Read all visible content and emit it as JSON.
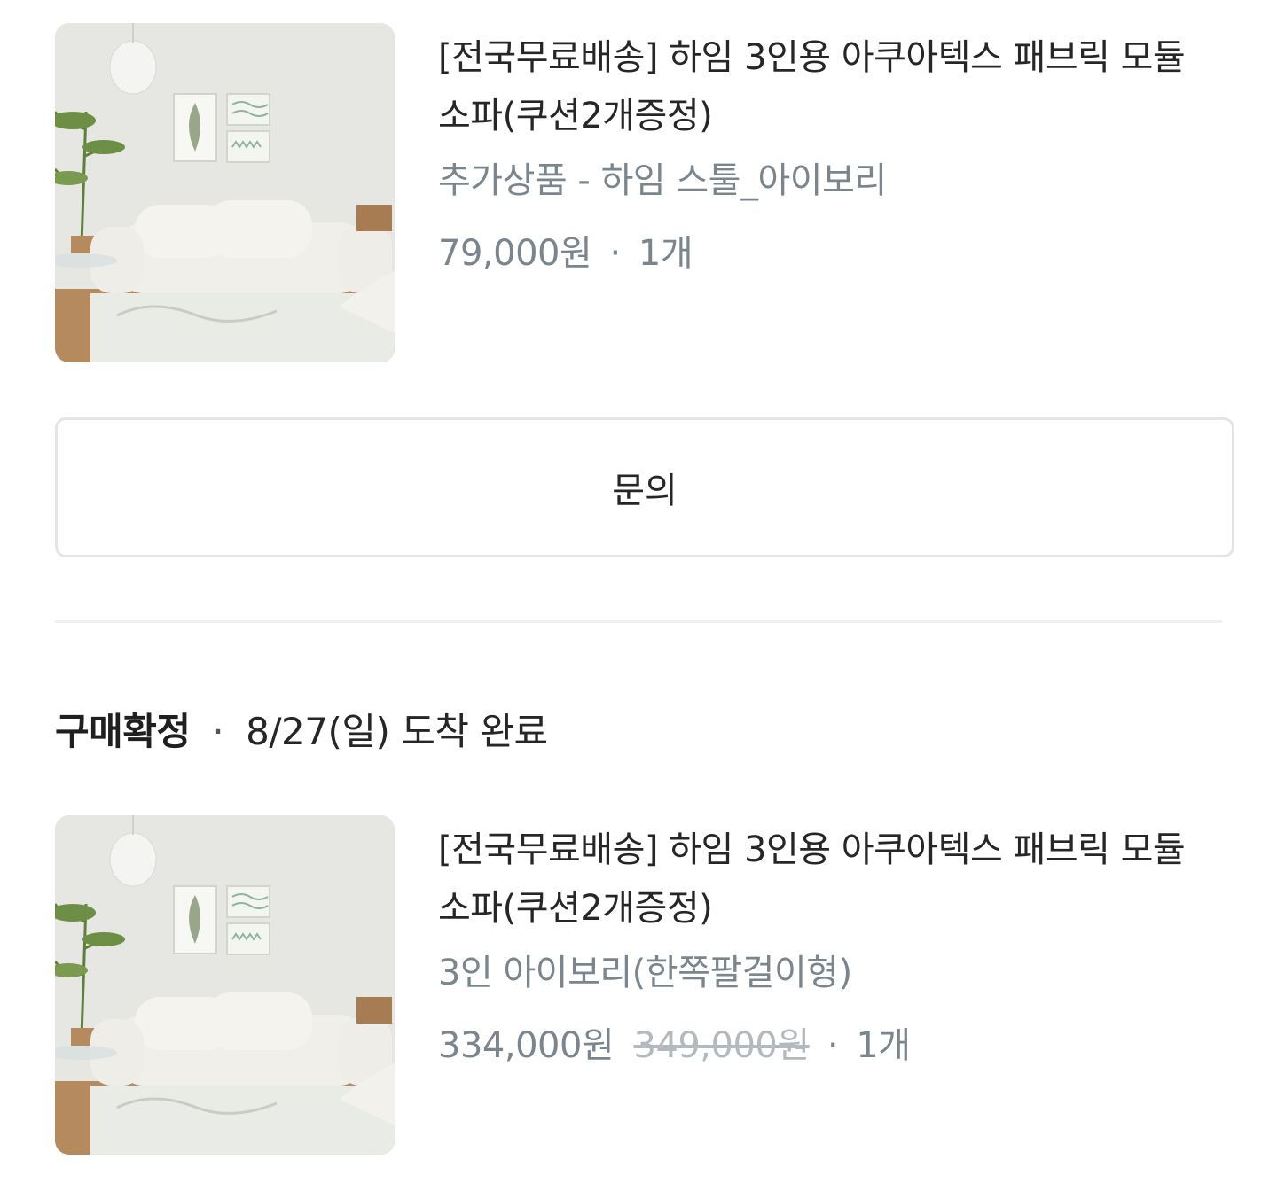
{
  "orders": [
    {
      "product": {
        "name": "[전국무료배송] 하임 3인용 아쿠아텍스 패브릭 모듈 소파(쿠션2개증정)",
        "option": "추가상품 - 하임 스툴_아이보리",
        "price": "79,000원",
        "separator": "·",
        "quantity": "1개"
      },
      "inquiry_button": "문의"
    },
    {
      "status": "구매확정",
      "status_separator": "·",
      "delivery_info": "8/27(일) 도착 완료",
      "product": {
        "name": "[전국무료배송] 하임 3인용 아쿠아텍스 패브릭 모듈 소파(쿠션2개증정)",
        "option": "3인 아이보리(한쪽팔걸이형)",
        "price": "334,000원",
        "original_price": "349,000원",
        "separator": "·",
        "quantity": "1개"
      }
    }
  ],
  "colors": {
    "title": "#262626",
    "muted": "#7b858d",
    "strike": "#b4b9be",
    "border": "#e3e5e8"
  }
}
